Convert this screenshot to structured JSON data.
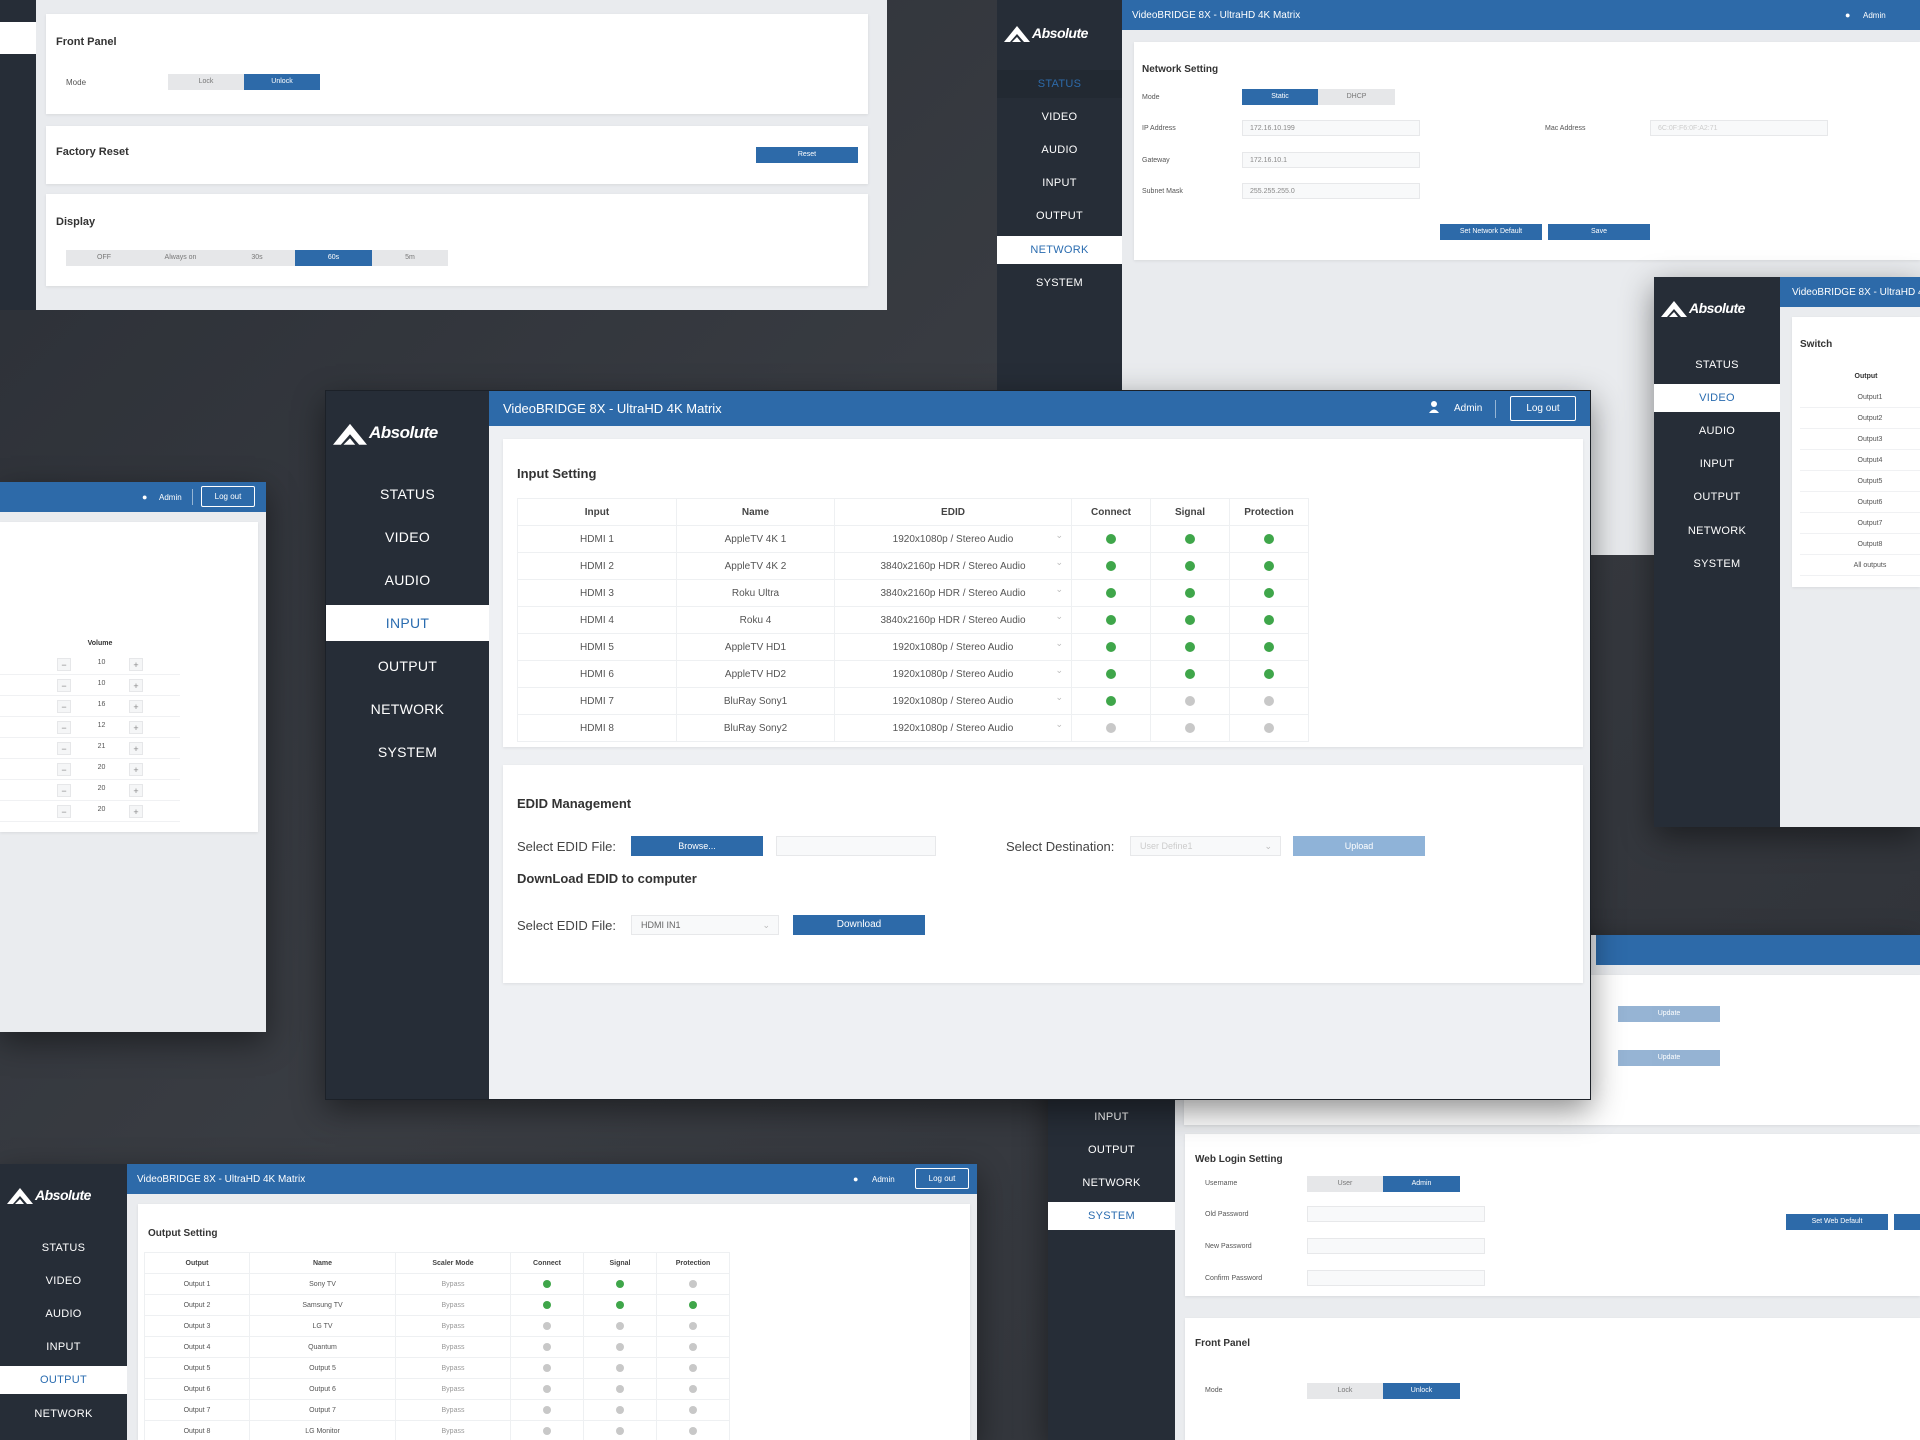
{
  "app": {
    "brand": "Absolute",
    "window_title": "VideoBRIDGE 8X - UltraHD 4K Matrix",
    "user": "Admin",
    "logout_label": "Log out"
  },
  "nav": [
    "STATUS",
    "VIDEO",
    "AUDIO",
    "INPUT",
    "OUTPUT",
    "NETWORK",
    "SYSTEM"
  ],
  "main": {
    "active_nav": "INPUT",
    "input_setting": {
      "title": "Input Setting",
      "columns": [
        "Input",
        "Name",
        "EDID",
        "Connect",
        "Signal",
        "Protection"
      ],
      "rows": [
        {
          "input": "HDMI 1",
          "name": "AppleTV 4K 1",
          "edid": "1920x1080p / Stereo Audio",
          "connect": true,
          "signal": true,
          "protection": true
        },
        {
          "input": "HDMI 2",
          "name": "AppleTV 4K 2",
          "edid": "3840x2160p HDR / Stereo Audio",
          "connect": true,
          "signal": true,
          "protection": true
        },
        {
          "input": "HDMI 3",
          "name": "Roku Ultra",
          "edid": "3840x2160p HDR / Stereo Audio",
          "connect": true,
          "signal": true,
          "protection": true
        },
        {
          "input": "HDMI 4",
          "name": "Roku 4",
          "edid": "3840x2160p HDR / Stereo Audio",
          "connect": true,
          "signal": true,
          "protection": true
        },
        {
          "input": "HDMI 5",
          "name": "AppleTV HD1",
          "edid": "1920x1080p / Stereo Audio",
          "connect": true,
          "signal": true,
          "protection": true
        },
        {
          "input": "HDMI 6",
          "name": "AppleTV HD2",
          "edid": "1920x1080p / Stereo Audio",
          "connect": true,
          "signal": true,
          "protection": true
        },
        {
          "input": "HDMI 7",
          "name": "BluRay Sony1",
          "edid": "1920x1080p / Stereo Audio",
          "connect": true,
          "signal": false,
          "protection": false
        },
        {
          "input": "HDMI 8",
          "name": "BluRay Sony2",
          "edid": "1920x1080p / Stereo Audio",
          "connect": false,
          "signal": false,
          "protection": false
        }
      ]
    },
    "edid": {
      "title": "EDID Management",
      "select_file_label": "Select EDID File:",
      "browse_label": "Browse...",
      "select_destination_label": "Select Destination:",
      "destination_value": "User Define1",
      "upload_label": "Upload",
      "download_title": "DownLoad EDID to computer",
      "download_select_label": "Select EDID File:",
      "download_select_value": "HDMI IN1",
      "download_label": "Download"
    }
  },
  "top_left": {
    "front_panel_title": "Front Panel",
    "mode_label": "Mode",
    "mode_options": [
      "Lock",
      "Unlock"
    ],
    "mode_selected": "Unlock",
    "factory_reset_title": "Factory Reset",
    "reset_label": "Reset",
    "display_title": "Display",
    "display_options": [
      "OFF",
      "Always on",
      "30s",
      "60s",
      "5m"
    ],
    "display_selected": "60s"
  },
  "top_right": {
    "active_nav": "NETWORK",
    "title": "Network Setting",
    "mode_label": "Mode",
    "mode_options": [
      "Static",
      "DHCP"
    ],
    "mode_selected": "Static",
    "ip_label": "IP Address",
    "ip_value": "172.16.10.199",
    "mac_label": "Mac Address",
    "mac_value": "6C:0F:F6:0F:A2:71",
    "gateway_label": "Gateway",
    "gateway_value": "172.16.10.1",
    "subnet_label": "Subnet Mask",
    "subnet_value": "255.255.255.0",
    "set_default_label": "Set Network Default",
    "save_label": "Save"
  },
  "mid_right": {
    "active_nav": "VIDEO",
    "title": "Switch",
    "column": "Output",
    "items": [
      "Output1",
      "Output2",
      "Output3",
      "Output4",
      "Output5",
      "Output6",
      "Output7",
      "Output8",
      "All outputs"
    ]
  },
  "left_audio": {
    "column": "Volume",
    "values": [
      "10",
      "10",
      "16",
      "12",
      "21",
      "20",
      "20",
      "20"
    ]
  },
  "bottom_left": {
    "active_nav": "OUTPUT",
    "title": "Output Setting",
    "columns": [
      "Output",
      "Name",
      "Scaler Mode",
      "Connect",
      "Signal",
      "Protection"
    ],
    "rows": [
      {
        "output": "Output 1",
        "name": "Sony TV",
        "mode": "Bypass",
        "connect": true,
        "signal": true,
        "protection": false
      },
      {
        "output": "Output 2",
        "name": "Samsung TV",
        "mode": "Bypass",
        "connect": true,
        "signal": true,
        "protection": true
      },
      {
        "output": "Output 3",
        "name": "LG TV",
        "mode": "Bypass",
        "connect": false,
        "signal": false,
        "protection": false
      },
      {
        "output": "Output 4",
        "name": "Quantum",
        "mode": "Bypass",
        "connect": false,
        "signal": false,
        "protection": false
      },
      {
        "output": "Output 5",
        "name": "Output 5",
        "mode": "Bypass",
        "connect": false,
        "signal": false,
        "protection": false
      },
      {
        "output": "Output 6",
        "name": "Output 6",
        "mode": "Bypass",
        "connect": false,
        "signal": false,
        "protection": false
      },
      {
        "output": "Output 7",
        "name": "Output 7",
        "mode": "Bypass",
        "connect": false,
        "signal": false,
        "protection": false
      },
      {
        "output": "Output 8",
        "name": "LG Monitor",
        "mode": "Bypass",
        "connect": false,
        "signal": false,
        "protection": false
      }
    ]
  },
  "bottom_right": {
    "active_nav": "SYSTEM",
    "update_label": "Update",
    "web_login_title": "Web Login Setting",
    "username_label": "Username",
    "username_options": [
      "User",
      "Admin"
    ],
    "username_selected": "Admin",
    "old_password_label": "Old Password",
    "new_password_label": "New Password",
    "confirm_password_label": "Confirm Password",
    "set_web_default_label": "Set Web Default",
    "front_panel_title": "Front Panel",
    "mode_label": "Mode",
    "mode_options": [
      "Lock",
      "Unlock"
    ],
    "mode_selected": "Unlock"
  },
  "colors": {
    "brand_blue": "#2d6aa9",
    "sidebar": "#262d37",
    "status_on": "#3fa64a",
    "status_off": "#c8c8c8"
  }
}
